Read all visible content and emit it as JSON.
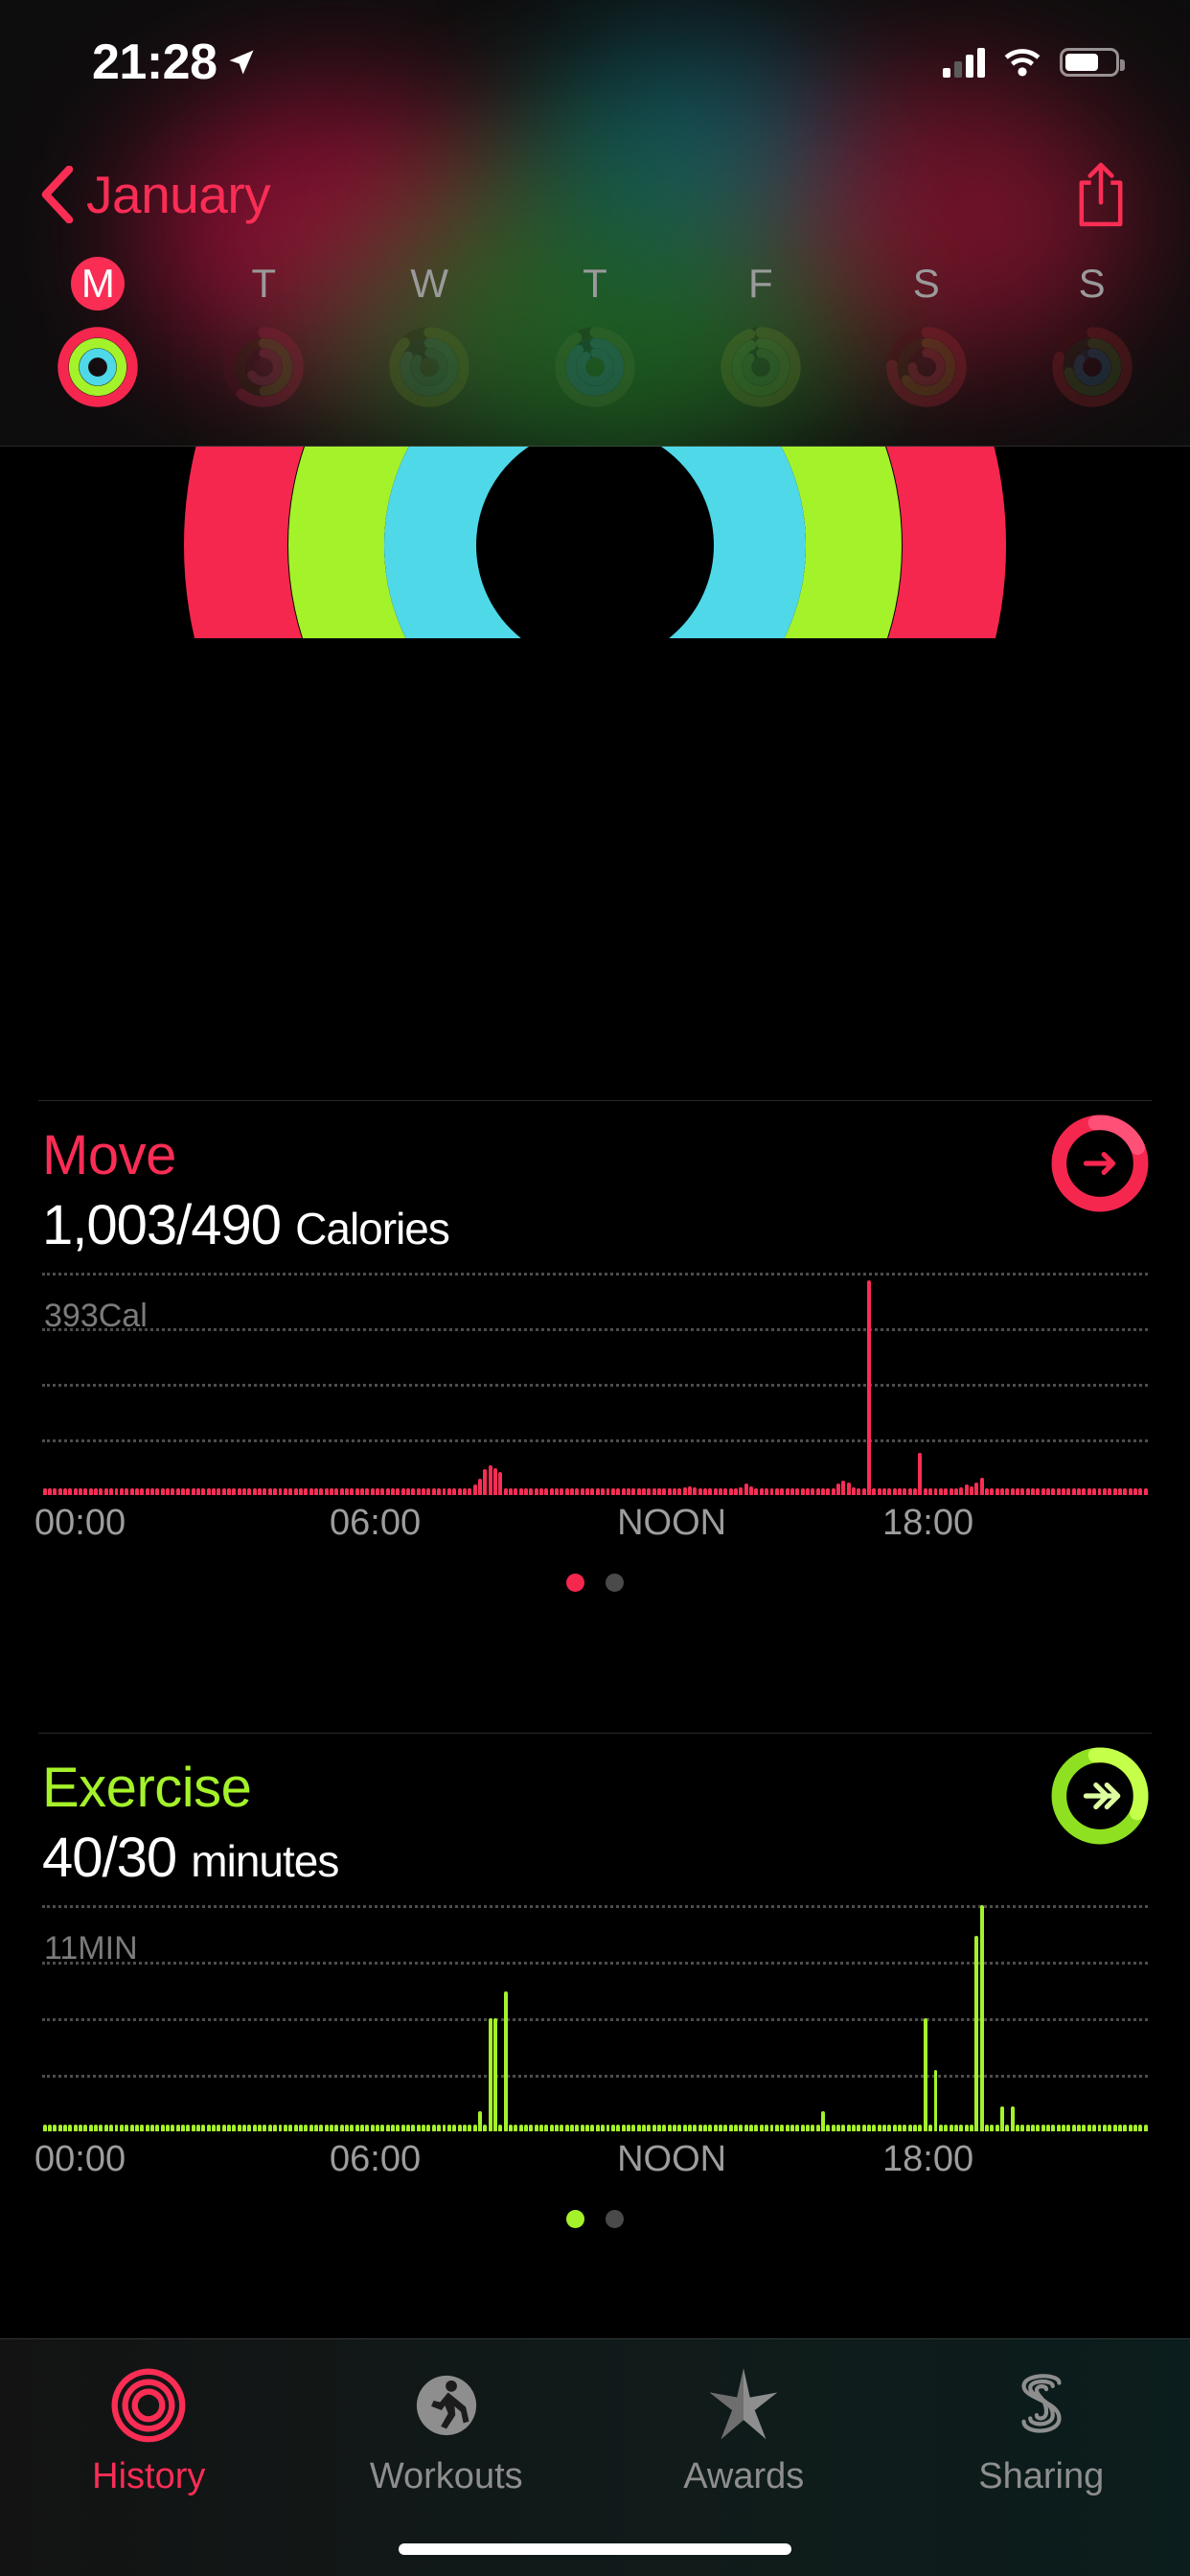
{
  "status_bar": {
    "time": "21:28",
    "location_icon": "location-arrow-icon",
    "signal_icon": "cellular-bars-icon",
    "wifi_icon": "wifi-icon",
    "battery_icon": "battery-icon"
  },
  "nav": {
    "back_label": "January",
    "back_icon": "chevron-left-icon",
    "share_icon": "share-up-icon"
  },
  "week": {
    "days": [
      {
        "letter": "M",
        "selected": true
      },
      {
        "letter": "T",
        "selected": false
      },
      {
        "letter": "W",
        "selected": false
      },
      {
        "letter": "T",
        "selected": false
      },
      {
        "letter": "F",
        "selected": false
      },
      {
        "letter": "S",
        "selected": false
      },
      {
        "letter": "S",
        "selected": false
      }
    ]
  },
  "colors": {
    "move": "#fa2d55",
    "exercise": "#a4f22a",
    "stand": "#4fd8e8",
    "grid": "#4c4c4c",
    "inactive_tab": "#8e8e8e"
  },
  "move": {
    "title": "Move",
    "value": "1,003/490",
    "unit": "Calories",
    "badge_icon": "arrow-right-ring-icon"
  },
  "exercise": {
    "title": "Exercise",
    "value": "40/30",
    "unit": "minutes",
    "badge_icon": "double-chevron-ring-icon"
  },
  "tabs": [
    {
      "label": "History",
      "icon": "activity-rings-icon",
      "active": true
    },
    {
      "label": "Workouts",
      "icon": "running-person-icon",
      "active": false
    },
    {
      "label": "Awards",
      "icon": "star-badge-icon",
      "active": false
    },
    {
      "label": "Sharing",
      "icon": "sharing-s-icon",
      "active": false
    }
  ],
  "chart_data": [
    {
      "type": "bar",
      "title": "Move",
      "series_name": "Active calories",
      "ylabel_text": "393Cal",
      "ylabel_value": 393,
      "ylim": [
        0,
        393
      ],
      "grid": true,
      "gridlines": 4,
      "color": "#fa2d55",
      "xlabel": "",
      "ylabel": "Cal",
      "tick_labels": [
        "00:00",
        "06:00",
        "NOON",
        "18:00"
      ],
      "tick_positions": [
        0,
        25,
        50,
        75
      ],
      "x_resolution_minutes": 15,
      "page_dots": 2,
      "page_active": 0,
      "values": [
        5,
        5,
        5,
        5,
        5,
        5,
        5,
        5,
        5,
        5,
        5,
        5,
        5,
        5,
        5,
        5,
        5,
        5,
        5,
        5,
        5,
        5,
        5,
        5,
        5,
        5,
        5,
        5,
        5,
        5,
        5,
        5,
        5,
        5,
        5,
        5,
        5,
        5,
        5,
        5,
        5,
        5,
        5,
        5,
        5,
        5,
        5,
        5,
        5,
        5,
        5,
        5,
        5,
        5,
        5,
        5,
        5,
        5,
        5,
        5,
        5,
        5,
        5,
        5,
        5,
        5,
        5,
        5,
        5,
        5,
        5,
        5,
        5,
        5,
        5,
        5,
        5,
        5,
        5,
        5,
        5,
        5,
        8,
        12,
        18,
        28,
        45,
        52,
        48,
        40,
        10,
        6,
        5,
        5,
        5,
        5,
        5,
        5,
        5,
        6,
        8,
        6,
        5,
        5,
        5,
        5,
        5,
        6,
        8,
        10,
        9,
        7,
        6,
        5,
        5,
        5,
        5,
        5,
        5,
        5,
        5,
        5,
        6,
        7,
        9,
        13,
        16,
        13,
        9,
        6,
        5,
        5,
        5,
        5,
        5,
        8,
        14,
        20,
        16,
        11,
        8,
        5,
        5,
        5,
        5,
        5,
        5,
        5,
        5,
        5,
        5,
        5,
        6,
        8,
        11,
        20,
        26,
        22,
        14,
        8,
        5,
        380,
        5,
        5,
        5,
        6,
        5,
        5,
        5,
        5,
        5,
        75,
        6,
        5,
        5,
        5,
        7,
        11,
        9,
        13,
        18,
        16,
        22,
        30,
        12,
        6,
        5,
        5,
        5,
        5,
        5,
        5,
        5,
        5,
        5,
        5,
        5,
        5,
        5,
        5,
        5,
        5,
        5,
        5,
        5,
        5,
        5,
        5,
        5,
        5,
        5,
        5,
        5,
        5,
        5,
        5
      ]
    },
    {
      "type": "bar",
      "title": "Exercise",
      "series_name": "Exercise minutes",
      "ylabel_text": "11MIN",
      "ylabel_value": 11,
      "ylim": [
        0,
        11
      ],
      "grid": true,
      "gridlines": 4,
      "color": "#a4f22a",
      "xlabel": "",
      "ylabel": "MIN",
      "tick_labels": [
        "00:00",
        "06:00",
        "NOON",
        "18:00"
      ],
      "tick_positions": [
        0,
        25,
        50,
        75
      ],
      "x_resolution_minutes": 15,
      "page_dots": 2,
      "page_active": 0,
      "values": [
        0.2,
        0.2,
        0.2,
        0.2,
        0.2,
        0.2,
        0.2,
        0.2,
        0.2,
        0.2,
        0.2,
        0.2,
        0.2,
        0.2,
        0.2,
        0.2,
        0.2,
        0.2,
        0.2,
        0.2,
        0.2,
        0.2,
        0.2,
        0.2,
        0.2,
        0.2,
        0.2,
        0.2,
        0.2,
        0.2,
        0.2,
        0.2,
        0.2,
        0.2,
        0.2,
        0.2,
        0.2,
        0.2,
        0.2,
        0.2,
        0.2,
        0.2,
        0.2,
        0.2,
        0.2,
        0.2,
        0.2,
        0.2,
        0.2,
        0.2,
        0.2,
        0.2,
        0.2,
        0.2,
        0.2,
        0.2,
        0.2,
        0.2,
        0.2,
        0.2,
        0.2,
        0.2,
        0.2,
        0.2,
        0.2,
        0.2,
        0.2,
        0.2,
        0.2,
        0.2,
        0.2,
        0.2,
        0.2,
        0.2,
        0.2,
        0.2,
        0.2,
        0.2,
        0.2,
        0.2,
        0.2,
        0.2,
        0.2,
        0.2,
        0.2,
        1,
        0.2,
        5.5,
        5.5,
        0.2,
        6.8,
        0.2,
        0.2,
        0.2,
        0.2,
        0.2,
        0.2,
        0.2,
        0.2,
        0.2,
        0.2,
        0.2,
        0.2,
        0.2,
        0.2,
        0.2,
        0.2,
        0.2,
        0.2,
        0.2,
        0.2,
        0.2,
        0.2,
        0.2,
        0.2,
        0.2,
        0.2,
        0.2,
        0.2,
        0.2,
        0.2,
        0.2,
        0.2,
        0.2,
        0.2,
        0.2,
        0.2,
        0.2,
        0.2,
        0.2,
        0.2,
        0.2,
        0.2,
        0.2,
        0.2,
        0.2,
        0.2,
        0.2,
        0.2,
        0.2,
        0.2,
        0.2,
        0.2,
        0.2,
        0.2,
        0.2,
        0.2,
        0.2,
        0.2,
        0.2,
        0.2,
        0.2,
        1,
        0.2,
        0.2,
        0.2,
        0.2,
        0.2,
        0.2,
        0.2,
        0.2,
        0.2,
        0.2,
        0.2,
        0.2,
        0.2,
        0.2,
        0.2,
        0.2,
        0.2,
        0.2,
        0.2,
        5.5,
        0.2,
        3,
        0.2,
        0.2,
        0.2,
        0.2,
        0.2,
        0.2,
        0.2,
        9.5,
        11,
        0.2,
        0.2,
        0.2,
        1.2,
        0.2,
        1.2,
        0.2,
        0.2,
        0.2,
        0.2,
        0.2,
        0.2,
        0.2,
        0.2,
        0.2,
        0.2,
        0.2,
        0.2,
        0.2,
        0.2,
        0.2,
        0.2,
        0.2,
        0.2,
        0.2,
        0.2,
        0.2,
        0.2,
        0.2,
        0.2,
        0.2,
        0.2
      ]
    }
  ],
  "big_rings": {
    "move_pct": 2.05,
    "exercise_pct": 1.33,
    "stand_pct": 1.0
  }
}
